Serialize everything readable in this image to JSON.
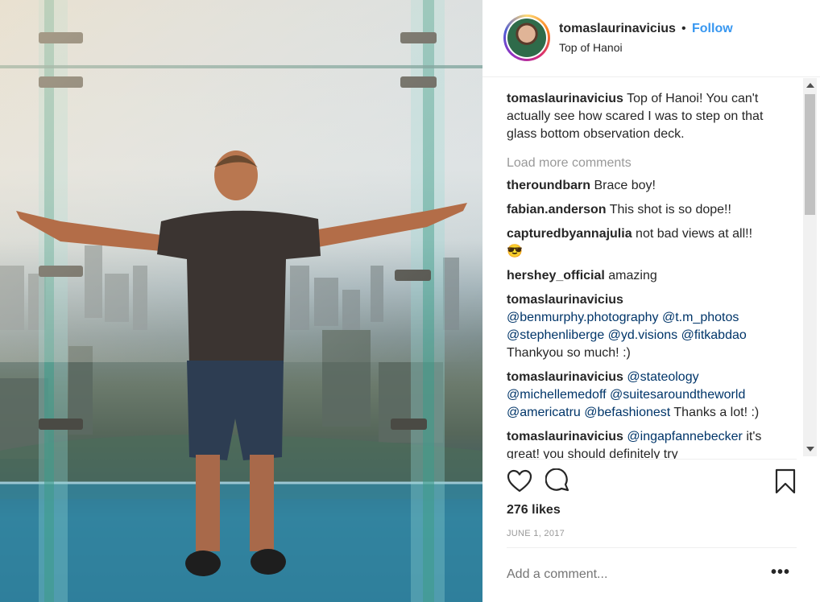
{
  "post": {
    "username": "tomaslaurinavicius",
    "separator": "•",
    "follow_label": "Follow",
    "location": "Top of Hanoi",
    "caption": "Top of Hanoi! You can't actually see how scared I was to step on that glass bottom observation deck.",
    "load_more": "Load more comments",
    "comments": [
      {
        "user": "theroundbarn",
        "text": "Brace boy!"
      },
      {
        "user": "fabian.anderson",
        "text": "This shot is so dope!!"
      },
      {
        "user": "capturedbyannajulia",
        "text": "not bad views at all!!",
        "emoji": "😎"
      },
      {
        "user": "hershey_official",
        "text": "amazing"
      },
      {
        "user": "tomaslaurinavicius",
        "mentions": "@benmurphy.photography @t.m_photos @stephenliberge @yd.visions @fitkabdao",
        "text": "Thankyou so much! :)"
      },
      {
        "user": "tomaslaurinavicius",
        "mentions": "@stateology @michellemedoff @suitesaroundtheworld @americatru @befashionest",
        "text": "Thanks a lot! :)"
      },
      {
        "user": "tomaslaurinavicius",
        "mentions": "@ingapfannebecker",
        "text": "it's great! you should definitely try"
      }
    ],
    "likes": "276 likes",
    "date": "JUNE 1, 2017",
    "add_comment_placeholder": "Add a comment...",
    "more_label": "•••"
  },
  "icons": {
    "like": "heart-icon",
    "comment": "comment-icon",
    "save": "bookmark-icon"
  },
  "colors": {
    "follow": "#3897f0",
    "mention": "#003569",
    "muted": "#999999"
  }
}
